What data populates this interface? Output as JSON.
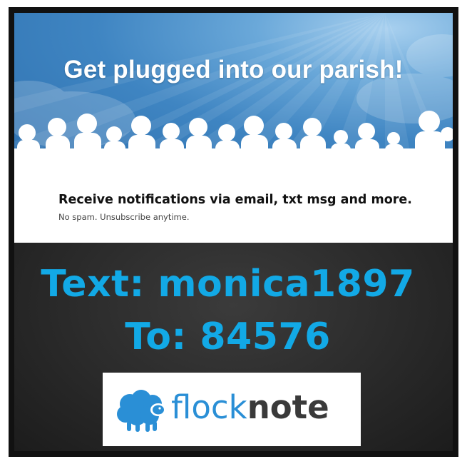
{
  "banner": {
    "headline": "Get plugged into our parish!",
    "notify": "Receive notifications via email, txt msg and more.",
    "nospam": "No spam. Unsubscribe anytime."
  },
  "cta": {
    "text_line": "Text: monica1897",
    "to_line": "To: 84576"
  },
  "logo": {
    "flock": "flock",
    "note": "note"
  },
  "colors": {
    "accent": "#12a9e6",
    "logo_blue": "#2a8fd6",
    "dark_bg": "#2a2a2a"
  }
}
